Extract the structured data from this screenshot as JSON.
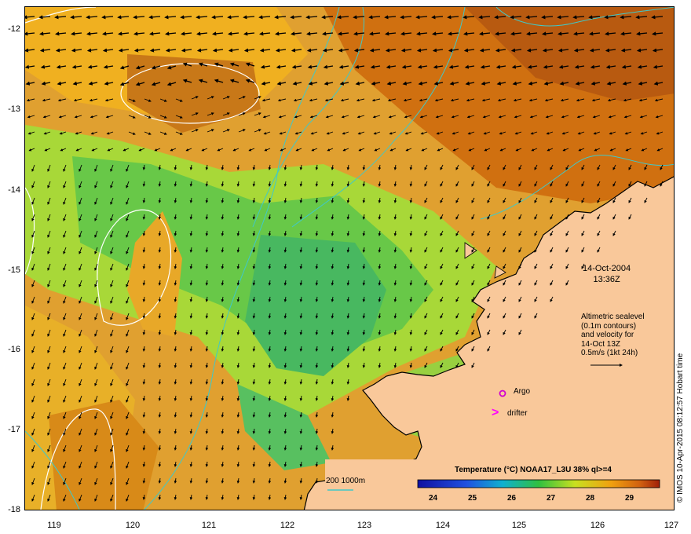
{
  "map": {
    "y_ticks": [
      "-12",
      "-13",
      "-14",
      "-15",
      "-16",
      "-17",
      "-18"
    ],
    "x_ticks": [
      "119",
      "120",
      "121",
      "122",
      "123",
      "124",
      "125",
      "126",
      "127"
    ],
    "date": "14-Oct-2004",
    "time": "13:36Z",
    "altimetry_note": [
      "Altimetric sealevel",
      "(0.1m contours)",
      "and velocity for",
      "14-Oct 13Z",
      "0.5m/s (1kt 24h)"
    ],
    "argo_label": "Argo",
    "drifter_label": "drifter",
    "drifter_symbol": ">",
    "bathymetry_label": "200  1000m",
    "colorbar_title": "Temperature (°C) NOAA17_L3U 38% ql>=4",
    "colorbar_ticks": [
      "24",
      "25",
      "26",
      "27",
      "28",
      "29"
    ],
    "credit": "© IMOS 10-Apr-2015 08:12:57 Hobart time",
    "colors": {
      "land": "#f9c89a",
      "coastline": "#000000",
      "bathymetry": "#40c8c8",
      "sealevel_contour": "#ffffff",
      "argo": "#d000d0",
      "drifter": "#ff00ff"
    }
  }
}
